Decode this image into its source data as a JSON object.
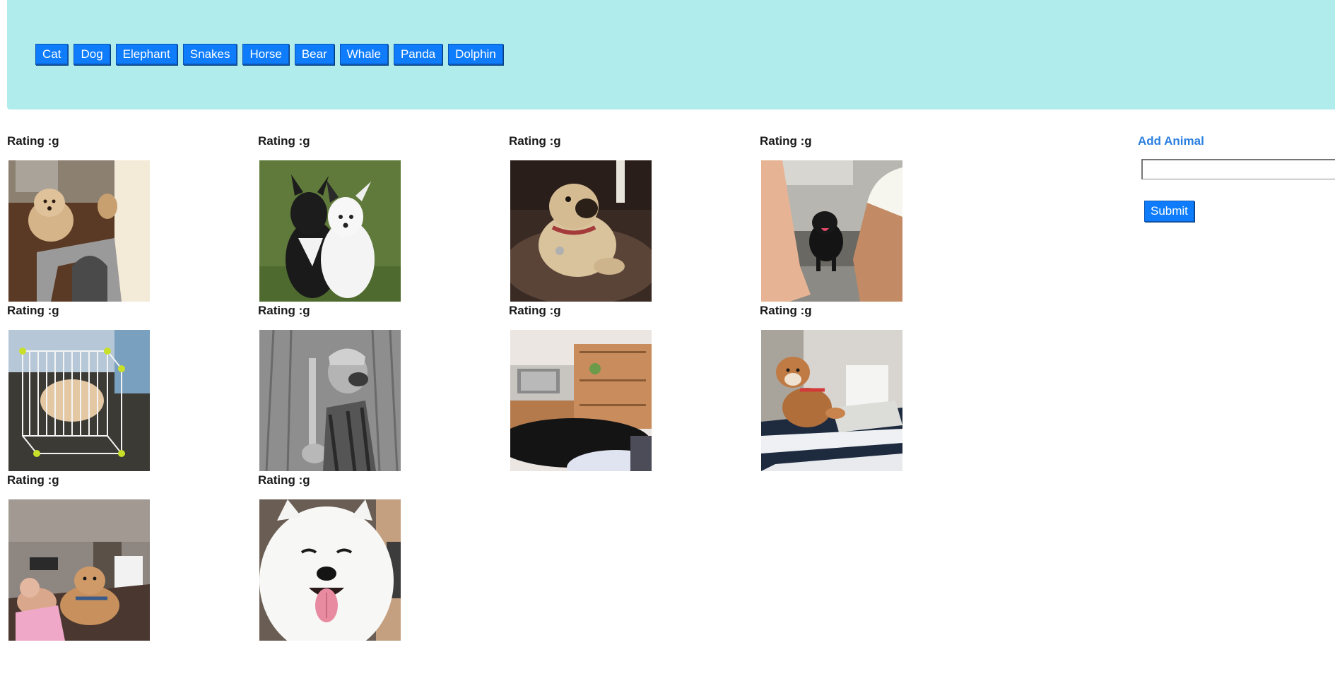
{
  "nav": {
    "buttons": [
      "Cat",
      "Dog",
      "Elephant",
      "Snakes",
      "Horse",
      "Bear",
      "Whale",
      "Panda",
      "Dolphin"
    ]
  },
  "gifs": [
    {
      "rating": "Rating :g",
      "image": "dog-on-kitchen-stool"
    },
    {
      "rating": "Rating :g",
      "image": "two-border-collies"
    },
    {
      "rating": "Rating :g",
      "image": "pug-on-couch"
    },
    {
      "rating": "Rating :g",
      "image": "black-puppy-kitchen"
    },
    {
      "rating": "Rating :g",
      "image": "pomeranian-in-playpen"
    },
    {
      "rating": "Rating :g",
      "image": "dog-with-saxophone"
    },
    {
      "rating": "Rating :g",
      "image": "black-dog-living-room"
    },
    {
      "rating": "Rating :g",
      "image": "shiba-on-laptop"
    },
    {
      "rating": "Rating :g",
      "image": "dog-on-sofa-with-woman"
    },
    {
      "rating": "Rating :g",
      "image": "smiling-samoyed"
    }
  ],
  "form": {
    "title": "Add Animal",
    "input_value": "",
    "submit_label": "Submit"
  },
  "colors": {
    "header_bg": "#b0ecec",
    "button_bg": "#0f7dfb",
    "link_blue": "#2b7fe0"
  }
}
